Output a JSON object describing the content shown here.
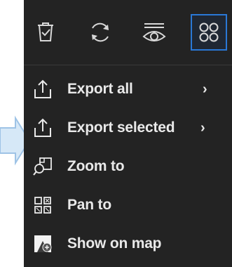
{
  "toolbar": {
    "buttons": [
      {
        "icon": "clear-selection-icon",
        "active": false
      },
      {
        "icon": "refresh-icon",
        "active": false
      },
      {
        "icon": "visibility-icon",
        "active": false
      },
      {
        "icon": "options-grid-icon",
        "active": true
      }
    ]
  },
  "menu": {
    "items": [
      {
        "label": "Export all",
        "icon": "export-icon",
        "has_submenu": true,
        "chevron": "›"
      },
      {
        "label": "Export selected",
        "icon": "export-icon",
        "has_submenu": true,
        "chevron": "›"
      },
      {
        "label": "Zoom to",
        "icon": "zoom-to-icon",
        "has_submenu": false
      },
      {
        "label": "Pan to",
        "icon": "pan-to-icon",
        "has_submenu": false
      },
      {
        "label": "Show on map",
        "icon": "show-on-map-icon",
        "has_submenu": false
      }
    ]
  },
  "colors": {
    "panel_bg": "#232323",
    "text": "#e9e9e9",
    "accent": "#2a78d6",
    "pointer": "#9ec3e6"
  }
}
